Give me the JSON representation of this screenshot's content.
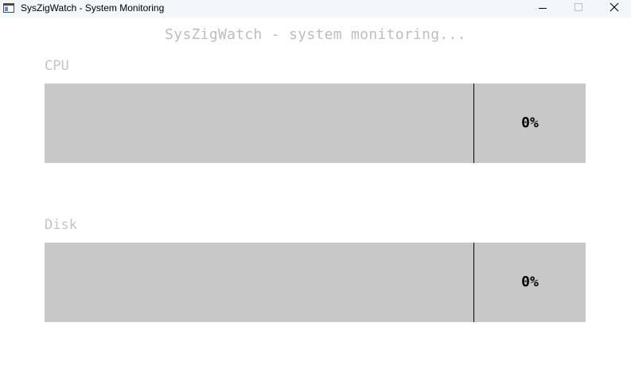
{
  "window": {
    "title": "SysZigWatch - System Monitoring",
    "controls": {
      "minimize_icon": "minimize-icon",
      "maximize_icon": "maximize-icon",
      "close_icon": "close-icon"
    }
  },
  "header": {
    "text": "SysZigWatch - system monitoring..."
  },
  "meters": {
    "cpu": {
      "label": "CPU",
      "value_text": "0%",
      "fraction": 0
    },
    "disk": {
      "label": "Disk",
      "value_text": "0%",
      "fraction": 0
    }
  },
  "colors": {
    "meter_background": "#c8c8c8",
    "label_color": "#c4c4c4",
    "divider": "#000000"
  }
}
